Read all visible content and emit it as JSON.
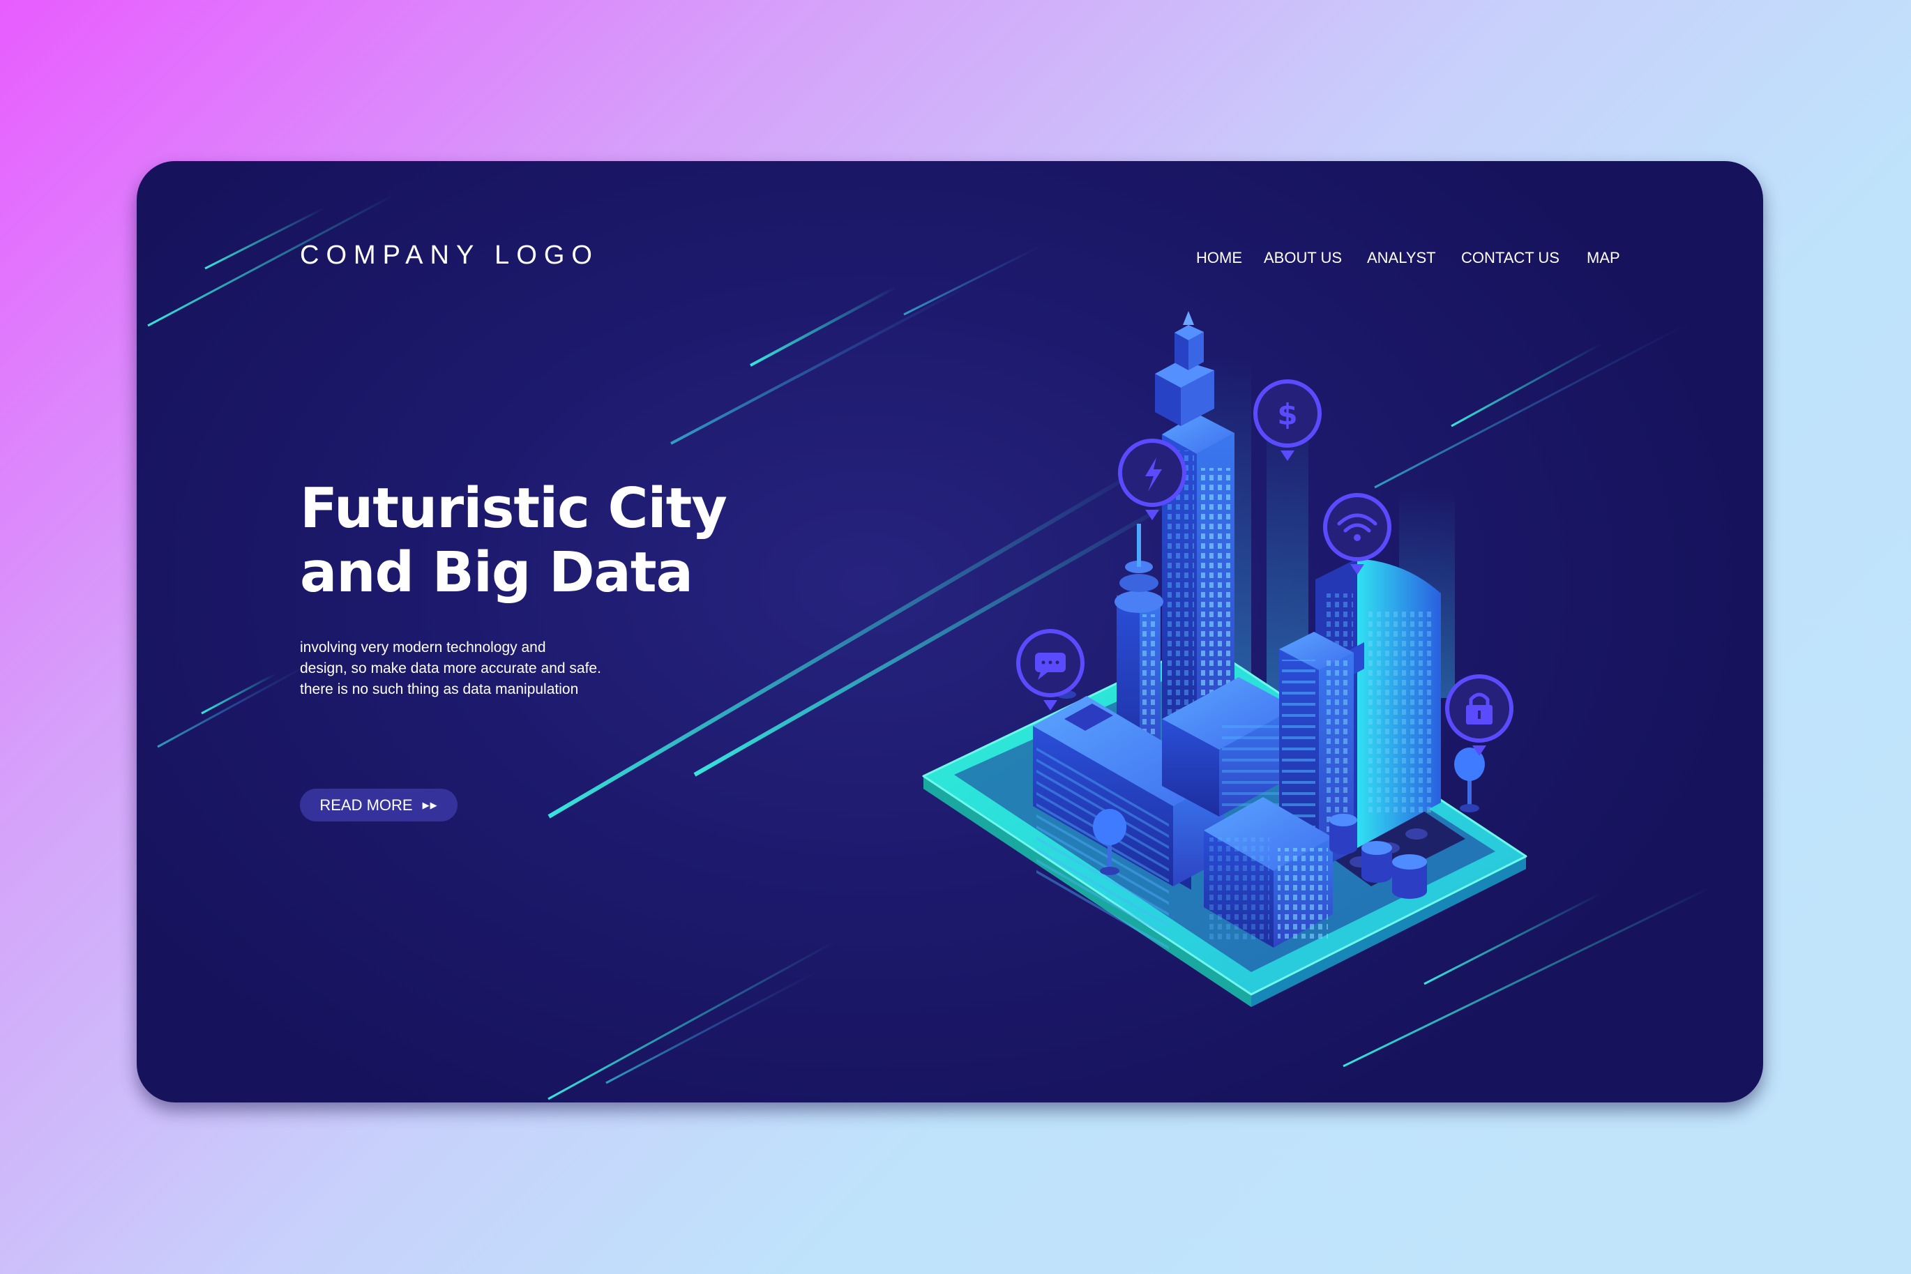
{
  "brand": {
    "logo_text": "COMPANY LOGO"
  },
  "nav": {
    "items": [
      "HOME",
      "ABOUT US",
      "ANALYST",
      "CONTACT US",
      "MAP"
    ]
  },
  "hero": {
    "title_line1": "Futuristic City",
    "title_line2": "and Big Data",
    "description_lines": [
      "involving very modern technology and",
      "design, so make data more accurate and safe.",
      "there is no such thing as data manipulation"
    ],
    "cta_label": "READ MORE",
    "cta_icon": "double-triangle-right"
  },
  "illustration": {
    "icons": [
      "lightning-icon",
      "dollar-icon",
      "wifi-icon",
      "chat-icon",
      "lock-icon"
    ]
  },
  "colors": {
    "card_background": "#1d1a6e",
    "accent_cyan": "#2ee6d6",
    "accent_blue": "#4a5cff",
    "button_background": "#35339b"
  }
}
